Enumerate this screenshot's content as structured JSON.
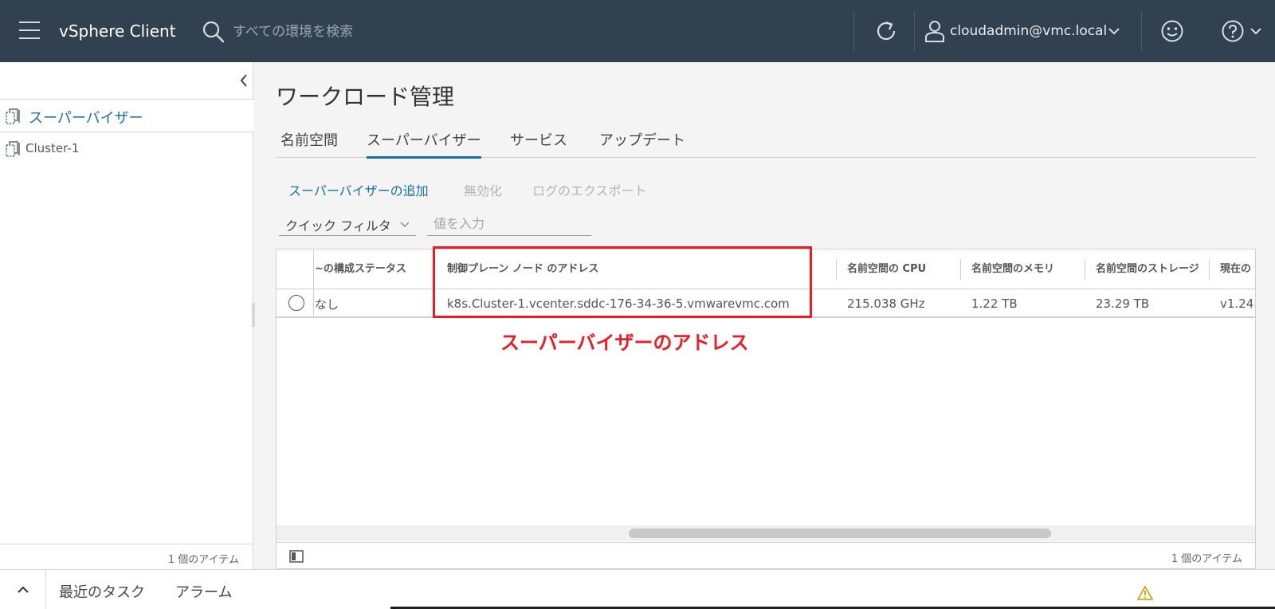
{
  "header": {
    "app_title": "vSphere Client",
    "search_placeholder": "すべての環境を検索",
    "user": "cloudadmin@vmc.local"
  },
  "left_panel": {
    "root_item": "スーパーバイザー",
    "items": [
      "Cluster-1"
    ],
    "footer_count": "1 個のアイテム"
  },
  "main": {
    "page_title": "ワークロード管理",
    "tabs": [
      {
        "label": "名前空間",
        "active": false
      },
      {
        "label": "スーパーバイザー",
        "active": true
      },
      {
        "label": "サービス",
        "active": false
      },
      {
        "label": "アップデート",
        "active": false
      }
    ],
    "actions": {
      "add": "スーパーバイザーの追加",
      "disable": "無効化",
      "export_logs": "ログのエクスポート"
    },
    "quick_filter_label": "クイック フィルタ",
    "filter_placeholder": "値を入力"
  },
  "grid": {
    "columns": [
      "~の構成ステータス",
      "制御プレーン ノード のアドレス",
      "名前空間の CPU",
      "名前空間のメモリ",
      "名前空間のストレージ",
      "現在の"
    ],
    "rows": [
      {
        "config_status": "なし",
        "control_plane_address": "k8s.Cluster-1.vcenter.sddc-176-34-36-5.vmwarevmc.com",
        "cpu": "215.038 GHz",
        "memory": "1.22 TB",
        "storage": "23.29 TB",
        "version": "v1.24."
      }
    ],
    "footer_count": "1 個のアイテム"
  },
  "annotation": {
    "label": "スーパーバイザーのアドレス",
    "color": "#ea1c24"
  },
  "bottom_bar": {
    "tabs": [
      "最近のタスク",
      "アラーム"
    ]
  },
  "colors": {
    "header_bg": "#314150",
    "link": "#1a6fa8",
    "annotation": "#ea1c24"
  }
}
